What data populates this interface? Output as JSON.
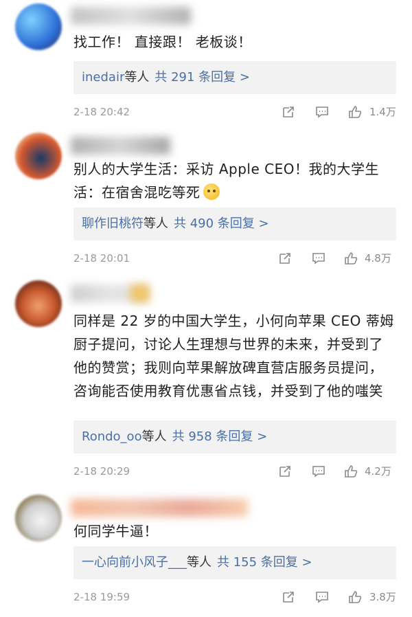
{
  "comments": [
    {
      "text": "找工作！ 直接跟！ 老板谈！",
      "reply_user": "inedair",
      "reply_mid": "等人",
      "reply_total": "共 291 条回复 >",
      "time": "2-18 20:42",
      "likes": "1.4万"
    },
    {
      "text": "别人的大学生活：采访 Apple CEO！我的大学生活：在宿舍混吃等死",
      "reply_user": "聊作旧桃符",
      "reply_mid": "等人",
      "reply_total": "共 490 条回复 >",
      "time": "2-18 20:01",
      "likes": "4.8万"
    },
    {
      "text": "同样是 22 岁的中国大学生，小何向苹果 CEO 蒂姆厨子提问，讨论人生理想与世界的未来，并受到了他的赞赏；我则向苹果解放碑直营店服务员提问，咨询能否使用教育优惠省点钱，并受到了他的嗤笑",
      "reply_user": "Rondo_oo",
      "reply_mid": "等人",
      "reply_total": "共 958 条回复 >",
      "time": "2-18 20:29",
      "likes": "4.2万"
    },
    {
      "text": "何同学牛逼！",
      "reply_user": "一心向前小风子___",
      "reply_mid": "等人",
      "reply_total": "共 155 条回复 >",
      "time": "2-18 19:59",
      "likes": "3.8万"
    }
  ],
  "icons": [
    "share-icon",
    "comment-icon",
    "like-icon",
    "thinking-emoji-icon"
  ]
}
